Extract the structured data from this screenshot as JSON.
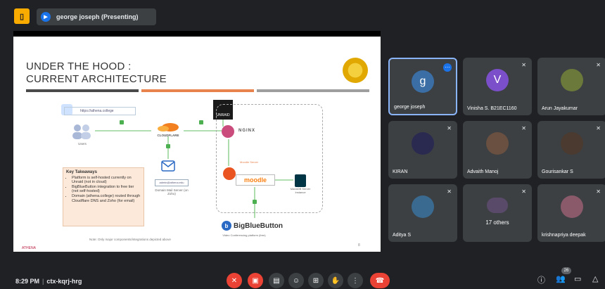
{
  "topbar": {
    "presenter_label": "george joseph (Presenting)"
  },
  "slide": {
    "title_line1": "UNDER THE HOOD :",
    "title_line2": "CURRENT ARCHITECTURE",
    "url": "https://athena.college",
    "users_label": "Users",
    "cloudflare_label": "CLOUDFLARE",
    "unraid_label": "UNRAID",
    "nginx_label": "NGINX",
    "mail_box": "admin@athena.edu",
    "mail_label": "Domain Mail Server (on Zoho)",
    "moodle_small": "Moodle Server",
    "moodle_label": "moodle",
    "mariadb_label": "MariaDB Server Instance",
    "takeaways_title": "Key Takeaways",
    "takeaways": [
      "Platform is self-hosted currently on Unraid (not in cloud)",
      "BigBlueButton integration to free tier (not self-hosted)",
      "Domain (athena.college) routed through Cloudflare DNS and Zoho (for email)"
    ],
    "bbb_label": "BigBlueButton",
    "bbb_sub": "Video Conferencing platform (free)",
    "note": "Note: Only major components/integrations depicted above",
    "brand": "ATHENA",
    "page": "8"
  },
  "participants": [
    {
      "name": "george joseph",
      "initial": "g",
      "color": "#3a6ea5",
      "active": true
    },
    {
      "name": "Vinisha S. B21EC1160",
      "initial": "V",
      "color": "#7b4fc9",
      "active": false
    },
    {
      "name": "Arun Jayakumar",
      "initial": "",
      "color": "#6b7a3a",
      "active": false
    },
    {
      "name": "KIRAN",
      "initial": "",
      "color": "#2a2a50",
      "active": false
    },
    {
      "name": "Advaith Manoj",
      "initial": "",
      "color": "#6a5040",
      "active": false
    },
    {
      "name": "Gourisankar S",
      "initial": "",
      "color": "#4a3a30",
      "active": false
    },
    {
      "name": "Aditya S",
      "initial": "",
      "color": "#3a6a90",
      "active": false
    },
    {
      "name": "17 others",
      "initial": "",
      "color": "#5a4a6a",
      "active": false
    },
    {
      "name": "krishnapriya deepak",
      "initial": "",
      "color": "#8a5a6a",
      "active": false
    }
  ],
  "bottombar": {
    "time": "8:29 PM",
    "meeting_code": "ctx-kqrj-hrg",
    "participant_count": "26"
  }
}
